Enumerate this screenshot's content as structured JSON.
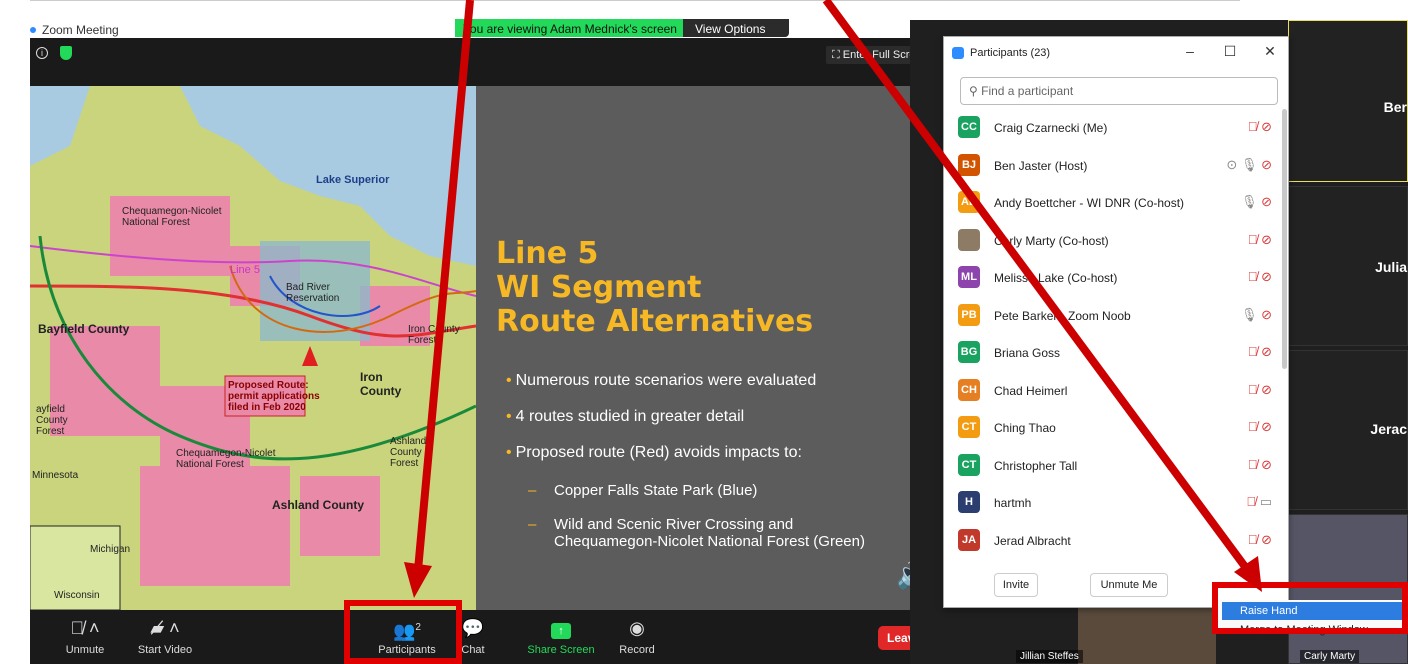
{
  "window": {
    "title": "Zoom Meeting",
    "viewing_banner": "You are viewing Adam Mednick's screen",
    "view_options": "View Options",
    "enter_full_screen": "Enter Full Screen"
  },
  "slide": {
    "title_lines": [
      "Line 5",
      "WI Segment",
      "Route Alternatives"
    ],
    "bullets": [
      "Numerous route scenarios were evaluated",
      "4 routes studied in greater detail",
      "Proposed route (Red) avoids impacts to:"
    ],
    "sub_bullets": [
      [
        "Copper Falls State Park (Blue)"
      ],
      [
        "Wild and Scenic River Crossing and",
        "Chequamegon-Nicolet National Forest (Green)"
      ]
    ],
    "map_labels": {
      "lake": "Lake Superior",
      "forest_top": [
        "Chequamegon-Nicolet",
        "National Forest"
      ],
      "line5": "Line 5",
      "bad_river": [
        "Bad River",
        "Reservation"
      ],
      "bayfield": "Bayfield County",
      "iron_county_forest": [
        "Iron County",
        "Forest"
      ],
      "iron_county": [
        "Iron",
        "County"
      ],
      "proposed_route": [
        "Proposed Route:",
        "permit applications",
        "filed in Feb 2020"
      ],
      "forest_bottom": [
        "Chequamegon-Nicolet",
        "National Forest"
      ],
      "ashland_forest": [
        "Ashland",
        "County",
        "Forest"
      ],
      "ashland": "Ashland County",
      "minnesota": "Minnesota",
      "michigan": "Michigan",
      "wisconsin": "Wisconsin",
      "bayfield_forest": [
        "ayfield",
        "County",
        "Forest"
      ]
    }
  },
  "toolbar": {
    "unmute": "Unmute",
    "start_video": "Start Video",
    "participants": "Participants",
    "participants_count": "2",
    "chat": "Chat",
    "share_screen": "Share Screen",
    "record": "Record",
    "leave": "Leave"
  },
  "participants_panel": {
    "title": "Participants (23)",
    "search_placeholder": "Find a participant",
    "invite": "Invite",
    "unmute_me": "Unmute Me",
    "people": [
      {
        "initials": "CC",
        "name": "Craig Czarnecki (Me)",
        "color": "#1aa260",
        "status": "muted"
      },
      {
        "initials": "BJ",
        "name": "Ben Jaster (Host)",
        "color": "#d35400",
        "status": "talking"
      },
      {
        "initials": "AB",
        "name": "Andy Boettcher - WI DNR (Co-host)",
        "color": "#f39c12",
        "status": "unmuted"
      },
      {
        "initials": "",
        "name": "Carly Marty (Co-host)",
        "color": "#8e7b66",
        "status": "muted"
      },
      {
        "initials": "ML",
        "name": "Melissa Lake (Co-host)",
        "color": "#8e44ad",
        "status": "muted"
      },
      {
        "initials": "PB",
        "name": "Pete Barker - Zoom Noob",
        "color": "#f39c12",
        "status": "unmuted"
      },
      {
        "initials": "BG",
        "name": "Briana Goss",
        "color": "#1aa260",
        "status": "muted"
      },
      {
        "initials": "CH",
        "name": "Chad Heimerl",
        "color": "#e67e22",
        "status": "muted"
      },
      {
        "initials": "CT",
        "name": "Ching Thao",
        "color": "#f39c12",
        "status": "muted"
      },
      {
        "initials": "CT",
        "name": "Christopher Tall",
        "color": "#1aa260",
        "status": "muted"
      },
      {
        "initials": "H",
        "name": "hartmh",
        "color": "#2c3e70",
        "status": "video"
      },
      {
        "initials": "JA",
        "name": "Jerad Albracht",
        "color": "#c0392b",
        "status": "muted"
      }
    ]
  },
  "gallery": {
    "tiles": [
      "Ber",
      "Julia",
      "Jerac"
    ],
    "bottom_names": [
      "Jillian Steffes",
      "Carly Marty"
    ]
  },
  "raise_menu": {
    "raise_hand": "Raise Hand",
    "merge": "Merge to Meeting Window"
  }
}
